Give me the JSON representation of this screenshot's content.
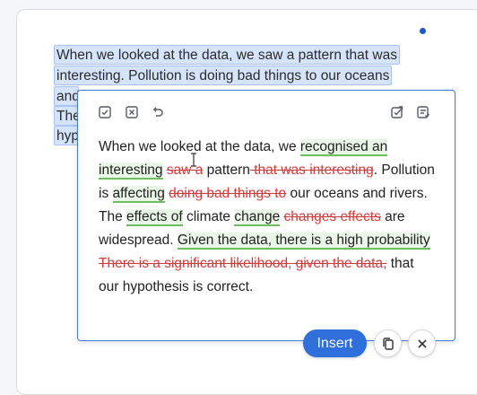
{
  "source": {
    "lines": [
      "When we looked at the data, we saw a pattern that was",
      "interesting. Pollution is doing bad things to our oceans",
      "and",
      "The",
      "hyp"
    ]
  },
  "popup": {
    "toolbar": {
      "left_icons": [
        "checkbox-icon",
        "close-box-icon",
        "undo-icon"
      ],
      "right_icons": [
        "accept-all-icon",
        "document-list-icon"
      ]
    },
    "segments": [
      {
        "t": "When we looked at the data, we ",
        "k": "plain"
      },
      {
        "t": "recognised an",
        "k": "add"
      },
      {
        "t": " ",
        "k": "plain"
      },
      {
        "t": "interesting",
        "k": "add"
      },
      {
        "t": " ",
        "k": "plain"
      },
      {
        "t": "saw a",
        "k": "del"
      },
      {
        "t": " pattern",
        "k": "plain"
      },
      {
        "t": " that was interesting",
        "k": "del"
      },
      {
        "t": ". Pollution is ",
        "k": "plain"
      },
      {
        "t": "affecting",
        "k": "add"
      },
      {
        "t": " ",
        "k": "plain"
      },
      {
        "t": "doing bad things to",
        "k": "del"
      },
      {
        "t": " our oceans and rivers. The ",
        "k": "plain"
      },
      {
        "t": "effects of",
        "k": "add"
      },
      {
        "t": " climate ",
        "k": "plain"
      },
      {
        "t": "change",
        "k": "add"
      },
      {
        "t": " ",
        "k": "plain"
      },
      {
        "t": "changes effects",
        "k": "del"
      },
      {
        "t": " are widespread. ",
        "k": "plain"
      },
      {
        "t": "Given the data, there is a high probability",
        "k": "add"
      },
      {
        "t": " ",
        "k": "plain"
      },
      {
        "t": "There is a significant likelihood, given the data,",
        "k": "del"
      },
      {
        "t": " that our hypothesis is correct.",
        "k": "plain"
      }
    ]
  },
  "actions": {
    "insert_label": "Insert"
  },
  "colors": {
    "accent": "#2f6fdb",
    "added_underline": "#6bbf5e",
    "deleted_text": "#d23b3b",
    "selection": "#d6e4fb"
  }
}
